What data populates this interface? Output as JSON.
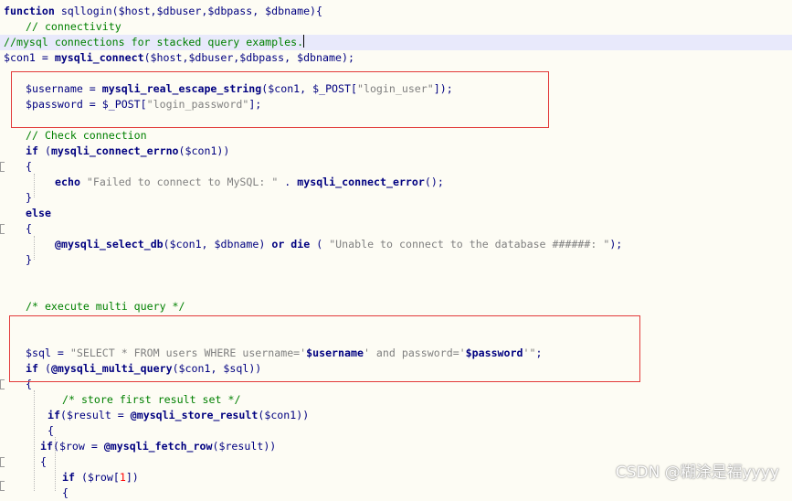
{
  "lines": [
    "function sqllogin($host,$dbuser,$dbpass, $dbname){",
    "// connectivity",
    "//mysql connections for stacked query examples.",
    "$con1 = mysqli_connect($host,$dbuser,$dbpass, $dbname);",
    "$username = mysqli_real_escape_string($con1, $_POST[\"login_user\"]);",
    "$password = $_POST[\"login_password\"];",
    "// Check connection",
    "if (mysqli_connect_errno($con1))",
    "{",
    "echo \"Failed to connect to MySQL: \" . mysqli_connect_error();",
    "}",
    "else",
    "{",
    "@mysqli_select_db($con1, $dbname) or die ( \"Unable to connect to the database ######: \");",
    "}",
    "/* execute multi query */",
    "$sql = \"SELECT * FROM users WHERE username='$username' and password='$password'\";",
    "if (@mysqli_multi_query($con1, $sql))",
    "{",
    "/* store first result set */",
    "if($result = @mysqli_store_result($con1))",
    "{",
    "if($row = @mysqli_fetch_row($result))",
    "{",
    "if ($row[1])",
    "{"
  ],
  "watermark": "CSDN @糊涂是福yyyy",
  "colors": {
    "background": "#fdfcf4",
    "code": "#000080",
    "string": "#808080",
    "comment": "#008000",
    "number": "#ff0000",
    "current_line": "#e8e9fb",
    "highlight_box": "#e23a3a"
  }
}
